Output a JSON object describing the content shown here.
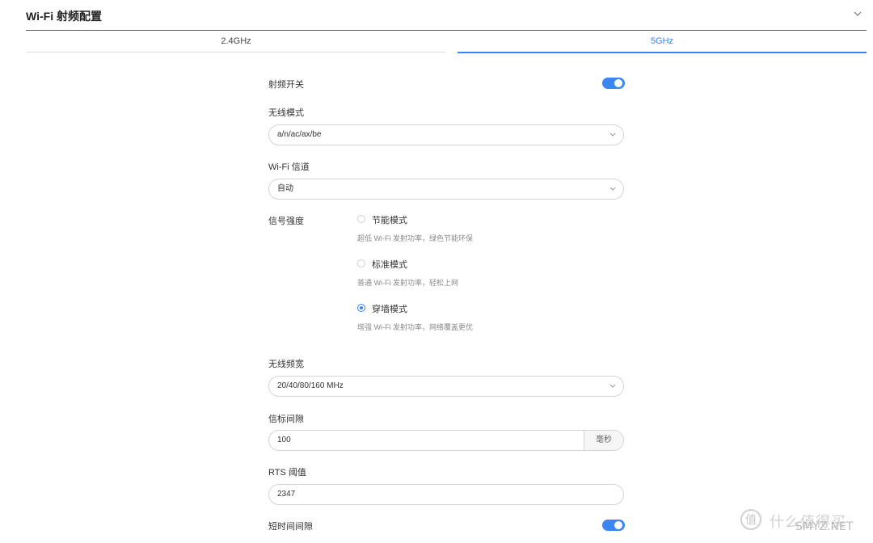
{
  "header": {
    "title": "Wi-Fi 射频配置"
  },
  "tabs": [
    {
      "label": "2.4GHz"
    },
    {
      "label": "5GHz"
    }
  ],
  "form": {
    "rf_switch": {
      "label": "射频开关",
      "on": true
    },
    "wireless_mode": {
      "label": "无线模式",
      "value": "a/n/ac/ax/be"
    },
    "channel": {
      "label": "Wi-Fi 信道",
      "value": "自动"
    },
    "signal": {
      "label": "信号强度",
      "options": [
        {
          "label": "节能模式",
          "desc": "超低 Wi-Fi 发射功率，绿色节能环保",
          "selected": false
        },
        {
          "label": "标准模式",
          "desc": "普通 Wi-Fi 发射功率，轻松上网",
          "selected": false
        },
        {
          "label": "穿墙模式",
          "desc": "增强 Wi-Fi 发射功率，网络覆盖更优",
          "selected": true
        }
      ]
    },
    "bandwidth": {
      "label": "无线频宽",
      "value": "20/40/80/160 MHz"
    },
    "beacon": {
      "label": "信标间隙",
      "value": "100",
      "unit": "毫秒"
    },
    "rts": {
      "label": "RTS 阈值",
      "value": "2347"
    },
    "short_gi": {
      "label": "短时间间隙",
      "on": true
    }
  },
  "watermark": {
    "glyph": "值",
    "text": "什么值得买",
    "site": "SMYZ.NET"
  },
  "colors": {
    "accent": "#3b82f6",
    "toggle": "#3b86f2"
  }
}
